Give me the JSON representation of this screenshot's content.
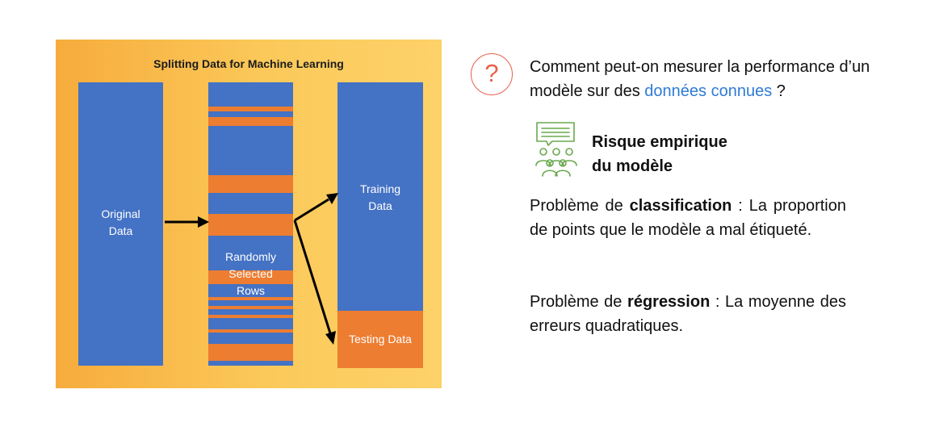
{
  "diagram": {
    "title": "Splitting Data for Machine Learning",
    "original_label_line1": "Original",
    "original_label_line2": "Data",
    "randomly_label_line1": "Randomly",
    "randomly_label_line2": "Selected",
    "randomly_label_line3": "Rows",
    "training_label_line1": "Training",
    "training_label_line2": "Data",
    "testing_label": "Testing Data",
    "colors": {
      "background": "#fbc95a",
      "data_blue": "#4472c4",
      "row_orange": "#ed7d31"
    }
  },
  "question": {
    "icon": "question-mark-circle-icon",
    "text_before": "Comment peut-on mesurer la performance d’un modèle sur des ",
    "highlight": "données connues",
    "text_after": " ?"
  },
  "risk": {
    "icon": "audience-discussion-icon",
    "title_line1": "Risque empirique",
    "title_line2": "du modèle"
  },
  "classification": {
    "prefix": "Problème de ",
    "keyword": "classification",
    "suffix": " : La proportion de points que le modèle a mal étiqueté."
  },
  "regression": {
    "prefix": "Problème de ",
    "keyword": "régression",
    "suffix": " :  La moyenne des erreurs quadratiques."
  }
}
